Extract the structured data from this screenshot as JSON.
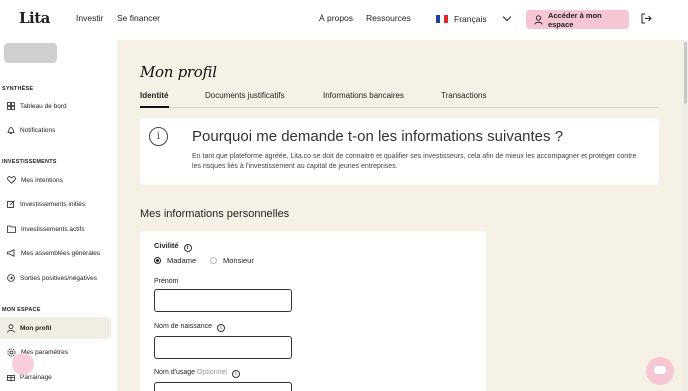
{
  "nav": {
    "logo": "Lita",
    "investir": "Investir",
    "se_financer": "Se financer",
    "apropos": "À propos",
    "ressources": "Ressources",
    "language": "Français",
    "cta": "Accéder à mon espace"
  },
  "sidebar": {
    "sections": [
      "SYNTHÈSE",
      "INVESTISSEMENTS",
      "MON ESPACE"
    ],
    "items": [
      {
        "label": "Tableau de bord",
        "icon": "dashboard-icon"
      },
      {
        "label": "Notifications",
        "icon": "bell-icon"
      },
      {
        "label": "Mes intentions",
        "icon": "heart-icon"
      },
      {
        "label": "Investissements initiés",
        "icon": "edit-icon"
      },
      {
        "label": "Investissements actifs",
        "icon": "folder-icon"
      },
      {
        "label": "Mes assemblées générales",
        "icon": "megaphone-icon"
      },
      {
        "label": "Sorties positives/négatives",
        "icon": "exit-icon"
      },
      {
        "label": "Mon profil",
        "icon": "user-icon",
        "active": true
      },
      {
        "label": "Mes paramètres",
        "icon": "gear-icon"
      },
      {
        "label": "Parrainage",
        "icon": "gift-icon"
      }
    ]
  },
  "main": {
    "title": "Mon profil",
    "tabs": [
      "Identité",
      "Documents justificatifs",
      "Informations bancaires",
      "Transactions"
    ],
    "info_title": "Pourquoi me demande t-on les informations suivantes ?",
    "info_text": "En tant que plateforme agréée, Lita.co se doit de connaitre et qualifier ses investisseurs, cela afin de mieux les accompagner et protéger contre les risques liés à l'investissement au capital de jeunes entreprises.",
    "section_title": "Mes informations personnelles",
    "civilite_label": "Civilité",
    "radio_madame": "Madame",
    "radio_monsieur": "Monsieur",
    "prenom_label": "Prénom",
    "prenom_value": "",
    "nom_naissance_label": "Nom de naissance",
    "nom_naissance_value": "",
    "nom_usage_label": "Nom d'usage",
    "nom_usage_optional": "Optionnel"
  },
  "colors": {
    "accent": "#f6c6d3",
    "main_bg": "#f6f1e7",
    "active_item": "#f2ede3"
  }
}
